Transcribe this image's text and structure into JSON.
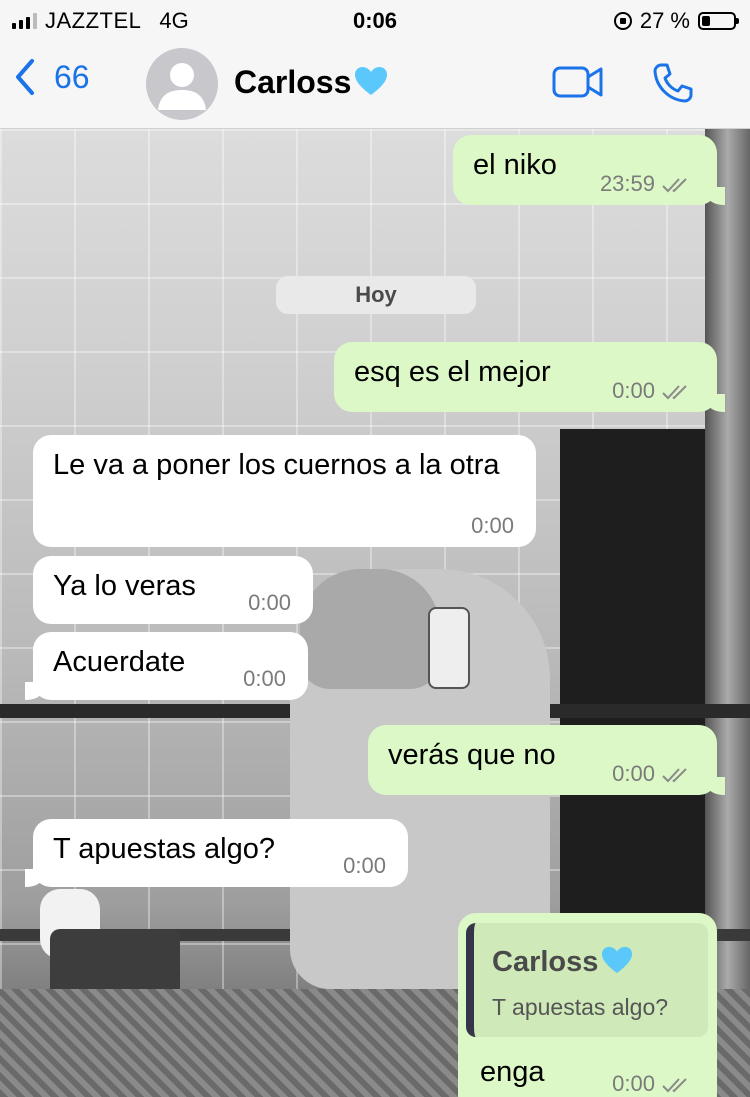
{
  "status_bar": {
    "carrier": "JAZZTEL",
    "network": "4G",
    "time": "0:06",
    "battery": "27 %",
    "battery_level": 0.27
  },
  "header": {
    "back_count": "66",
    "contact_name": "Carloss",
    "icons": {
      "back": "chevron-left-icon",
      "avatar": "person-icon",
      "video": "video-camera-icon",
      "call": "phone-icon"
    },
    "accent_color": "#1a73e8"
  },
  "colors": {
    "outgoing_bubble": "#dcf8c6",
    "incoming_bubble": "#ffffff",
    "heart": "#5ac8fa"
  },
  "date_separator": "Hoy",
  "messages": [
    {
      "direction": "outgoing",
      "text": "el niko",
      "time": "23:59",
      "status": "read"
    },
    {
      "direction": "outgoing",
      "text": "esq es el mejor",
      "time": "0:00",
      "status": "read"
    },
    {
      "direction": "incoming",
      "text": "Le va a poner los cuernos a la otra",
      "time": "0:00"
    },
    {
      "direction": "incoming",
      "text": "Ya lo veras",
      "time": "0:00"
    },
    {
      "direction": "incoming",
      "text": "Acuerdate",
      "time": "0:00"
    },
    {
      "direction": "outgoing",
      "text": "verás que no",
      "time": "0:00",
      "status": "read"
    },
    {
      "direction": "incoming",
      "text": "T apuestas algo?",
      "time": "0:00"
    },
    {
      "direction": "outgoing",
      "reply_to": {
        "name": "Carloss",
        "text": "T apuestas algo?"
      },
      "text": "enga",
      "time": "0:00",
      "status": "read"
    }
  ]
}
